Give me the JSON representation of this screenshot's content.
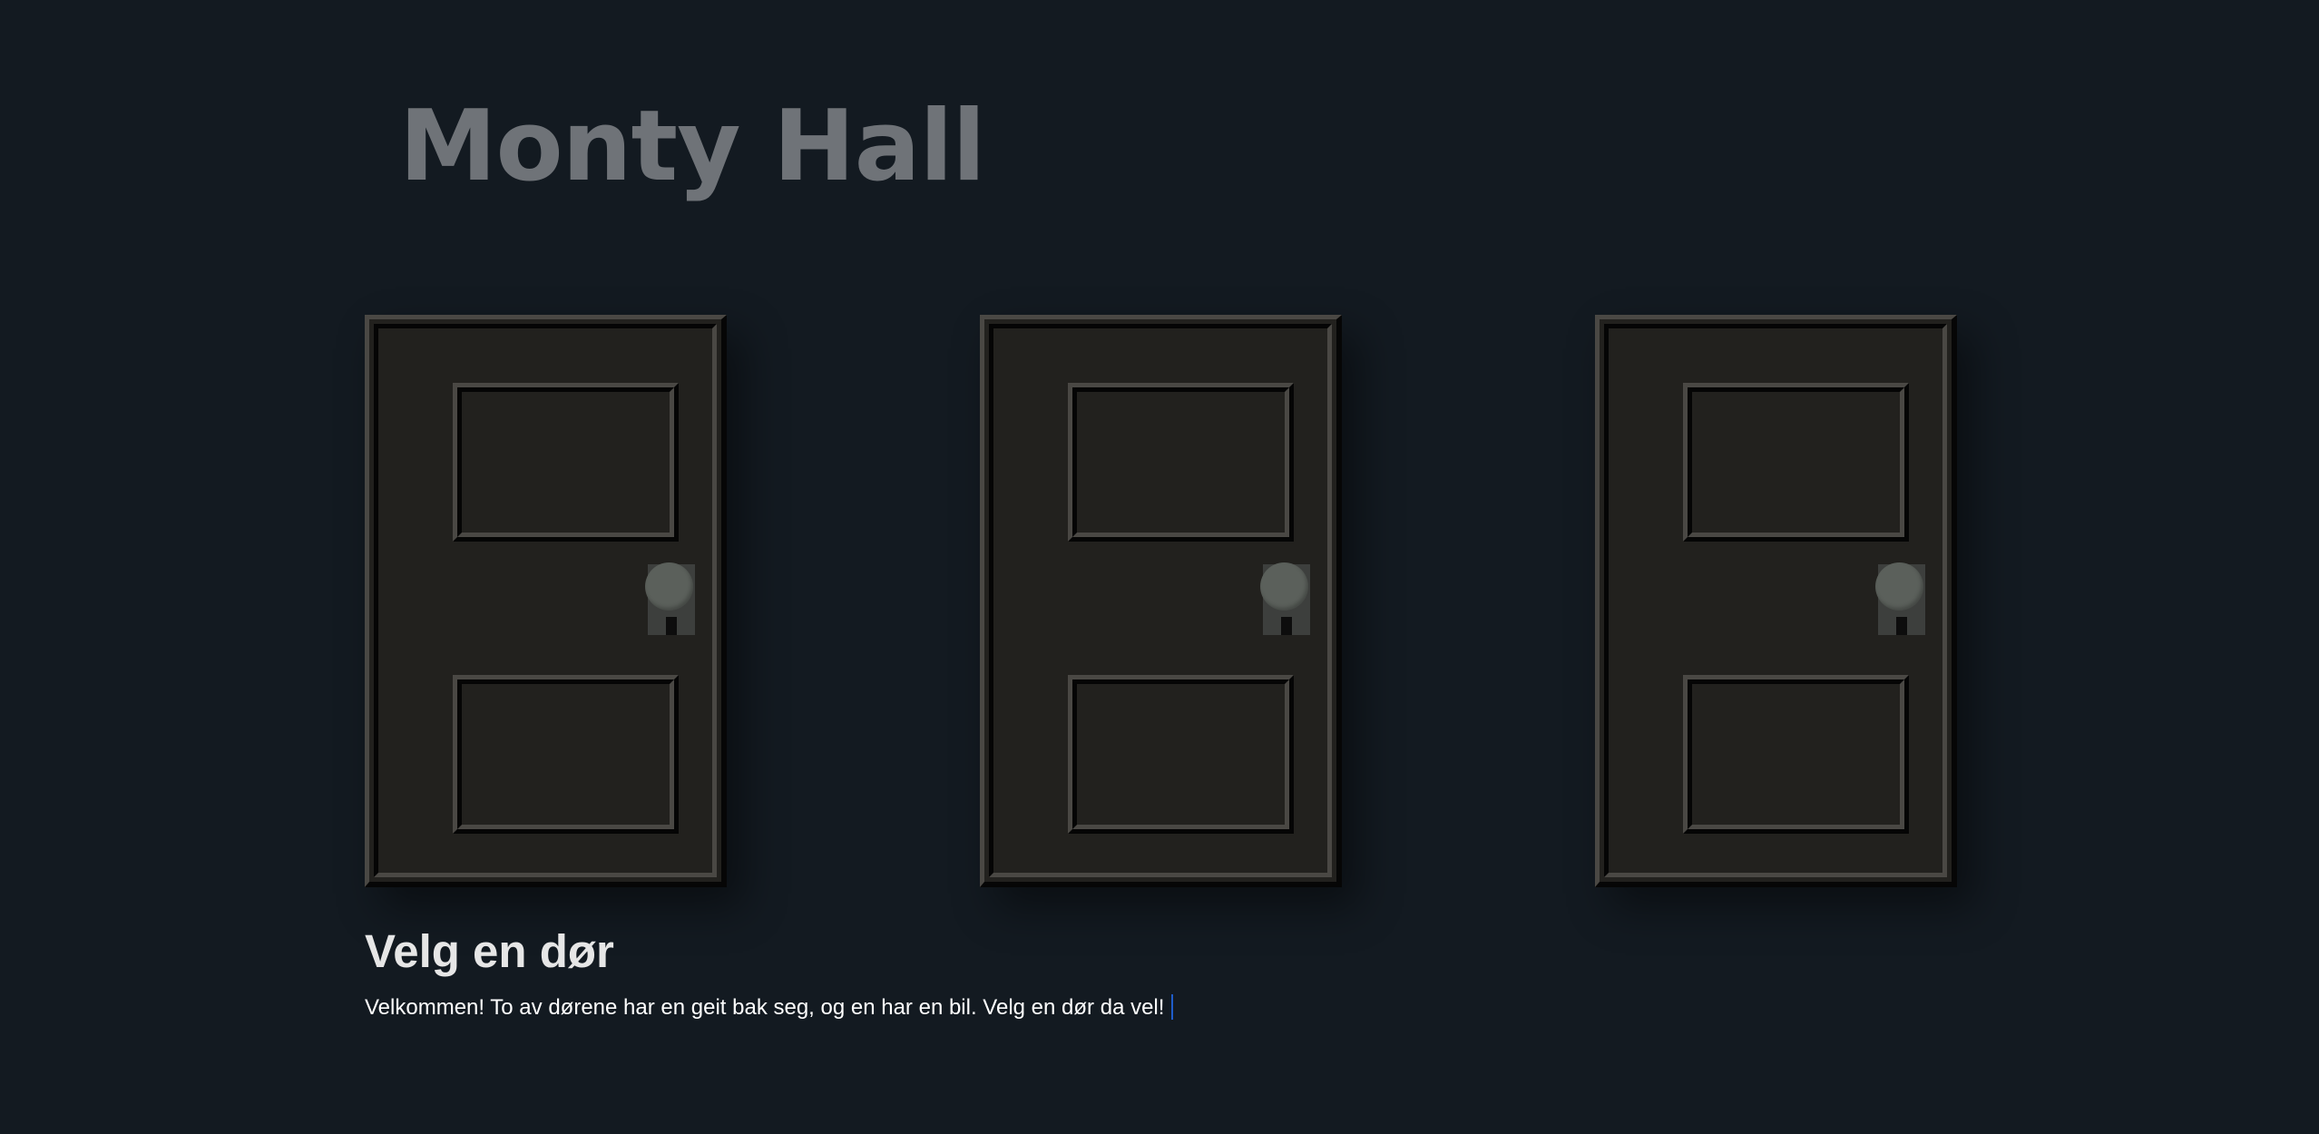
{
  "page": {
    "title": "Monty Hall"
  },
  "doors": [
    {
      "id": 1
    },
    {
      "id": 2
    },
    {
      "id": 3
    }
  ],
  "status": {
    "heading": "Velg en dør",
    "message": "Velkommen! To av dørene har en geit bak seg, og en har en bil. Velg en dør da vel!"
  },
  "colors": {
    "background": "#131a21",
    "title": "#6f7378",
    "door": "#22211e",
    "knob": "#5b605b",
    "text": "#e6e6e6"
  }
}
